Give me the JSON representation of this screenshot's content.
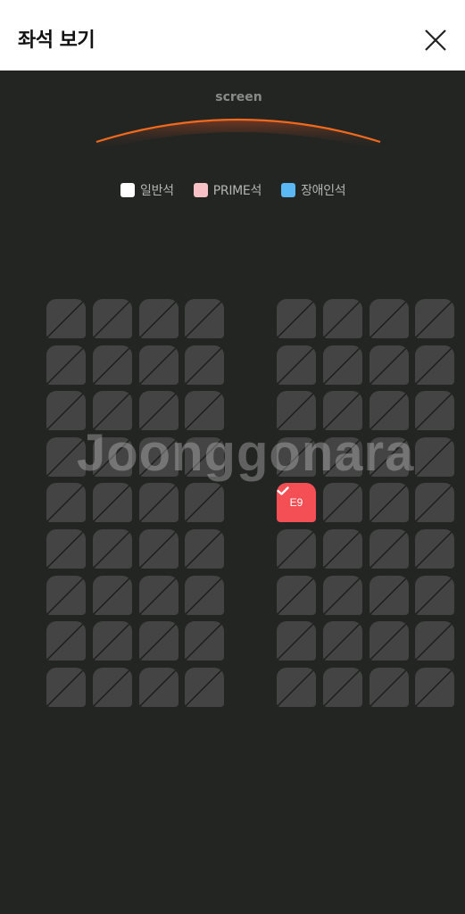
{
  "header": {
    "title": "좌석 보기"
  },
  "screen": {
    "label": "screen"
  },
  "legend": [
    {
      "label": "일반석",
      "color": "#ffffff"
    },
    {
      "label": "PRIME석",
      "color": "#f7c1c6"
    },
    {
      "label": "장애인석",
      "color": "#5bb8f5"
    }
  ],
  "seats": {
    "rows": 9,
    "columns": 8,
    "available_color": "#434443",
    "selected": {
      "row": 5,
      "column": 5,
      "label": "E9",
      "color": "#f34f55"
    }
  },
  "watermark": "Joonggonara"
}
